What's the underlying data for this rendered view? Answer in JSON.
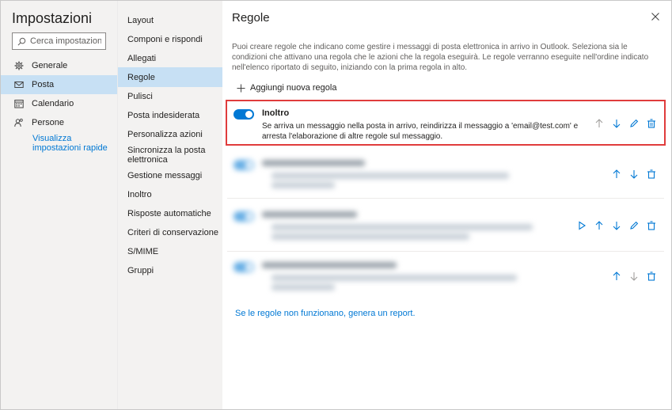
{
  "settings": {
    "title": "Impostazioni",
    "search_placeholder": "Cerca impostazioni",
    "nav": [
      {
        "label": "Generale",
        "icon": "gear-icon"
      },
      {
        "label": "Posta",
        "icon": "mail-icon"
      },
      {
        "label": "Calendario",
        "icon": "calendar-icon"
      },
      {
        "label": "Persone",
        "icon": "people-icon"
      }
    ],
    "quick_settings": "Visualizza impostazioni rapide"
  },
  "mail_menu": [
    "Layout",
    "Componi e rispondi",
    "Allegati",
    "Regole",
    "Pulisci",
    "Posta indesiderata",
    "Personalizza azioni",
    "Sincronizza la posta elettronica",
    "Gestione messaggi",
    "Inoltro",
    "Risposte automatiche",
    "Criteri di conservazione",
    "S/MIME",
    "Gruppi"
  ],
  "rules_page": {
    "title": "Regole",
    "description": "Puoi creare regole che indicano come gestire i messaggi di posta elettronica in arrivo in Outlook. Seleziona sia le condizioni che attivano una regola che le azioni che la regola eseguirà. Le regole verranno eseguite nell'ordine indicato nell'elenco riportato di seguito, iniziando con la prima regola in alto.",
    "add_rule": "Aggiungi nuova regola",
    "first_rule": {
      "name": "Inoltro",
      "text_line1": "Se arriva un messaggio nella posta in arrivo, reindirizza il messaggio a 'email@test.com' e",
      "text_line2": "arresta l'elaborazione di altre regole sul messaggio.",
      "enabled": true
    },
    "report_link": "Se le regole non funzionano, genera un report."
  },
  "colors": {
    "accent": "#0078d4",
    "selected": "#c7e0f4",
    "highlight": "#e03c3c"
  }
}
